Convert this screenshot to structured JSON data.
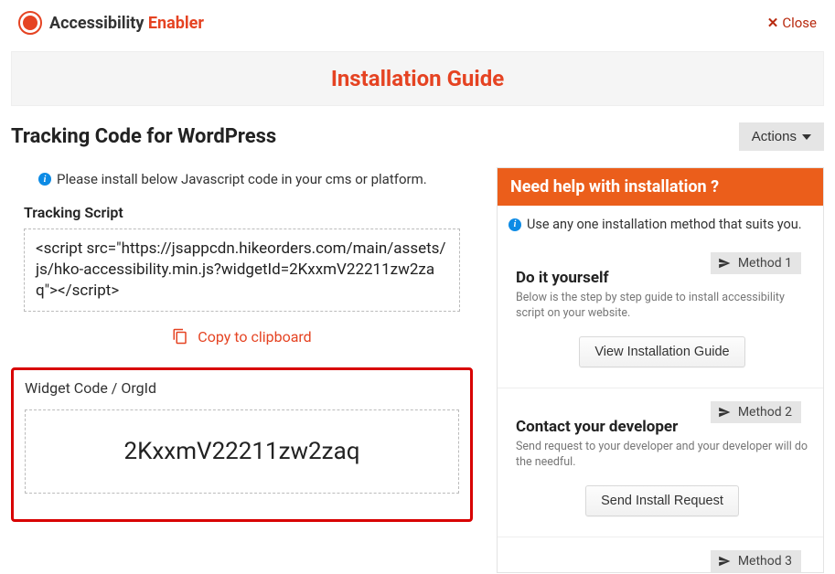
{
  "brand": {
    "part1": "Accessibility ",
    "part2": "Enabler"
  },
  "header": {
    "close": "Close"
  },
  "title": "Installation Guide",
  "subtitle": "Tracking Code for WordPress",
  "actions_label": "Actions",
  "info_left": "Please install below Javascript code in your cms or platform.",
  "tracking": {
    "label": "Tracking Script",
    "code": "<script src=\"https://jsappcdn.hikeorders.com/main/assets/js/hko-accessibility.min.js?widgetId=2KxxmV22211zw2zaq\"></script>",
    "copy": "Copy to clipboard"
  },
  "widget": {
    "label": "Widget Code / OrgId",
    "value": "2KxxmV22211zw2zaq"
  },
  "help": {
    "title": "Need help with installation ?",
    "info": "Use any one installation method that suits you.",
    "methods": [
      {
        "badge": "Method 1",
        "title": "Do it yourself",
        "desc": "Below is the step by step guide to install accessibility script on your website.",
        "button": "View Installation Guide"
      },
      {
        "badge": "Method 2",
        "title": "Contact your developer",
        "desc": "Send request to your developer and your developer will do the needful.",
        "button": "Send Install Request"
      },
      {
        "badge": "Method 3"
      }
    ]
  }
}
